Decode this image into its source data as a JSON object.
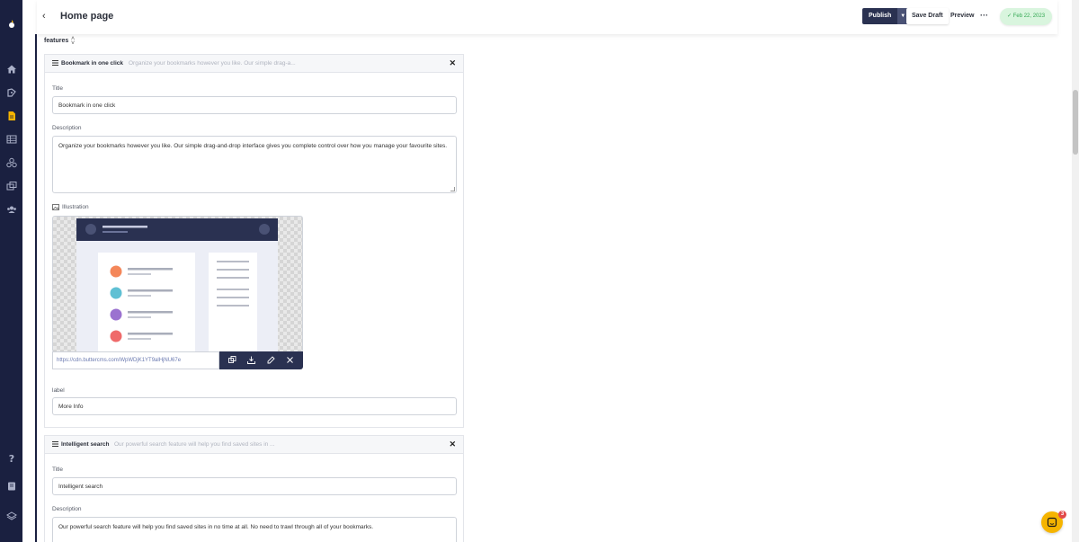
{
  "header": {
    "title": "Home page",
    "publish_label": "Publish",
    "save_draft_label": "Save Draft",
    "preview_label": "Preview",
    "more_label": "···",
    "date_badge": "Feb 22, 2023"
  },
  "section": {
    "label": "features"
  },
  "cards": [
    {
      "title": "Bookmark in one click",
      "preview": "Organize your bookmarks however you like. Our simple drag-a...",
      "close": "✕",
      "fields": {
        "title_label": "Title",
        "title_value": "Bookmark in one click",
        "description_label": "Description",
        "description_value": "Organize your bookmarks however you like. Our simple drag-and-drop interface gives you complete control over how you manage your favourite sites.",
        "illustration_label": "Illustration",
        "illustration_url": "https://cdn.buttercms.com/WpWDjK1YT9alHjNU67e",
        "label_label": "label",
        "label_value": "More Info"
      }
    },
    {
      "title": "Intelligent search",
      "preview": "Our powerful search feature will help you find saved sites in ...",
      "close": "✕",
      "fields": {
        "title_label": "Title",
        "title_value": "Intelligent search",
        "description_label": "Description",
        "description_value": "Our powerful search feature will help you find saved sites in no time at all. No need to trawl through all of your bookmarks."
      }
    }
  ],
  "chat": {
    "badge_count": "3"
  },
  "colors": {
    "nav": "#1a2040",
    "primary": "#2a3151",
    "success_bg": "#d9f5de",
    "success_text": "#34a853",
    "chat": "#f5b400"
  },
  "icons": {
    "nav": [
      "logo-icon",
      "home-icon",
      "blog-icon",
      "pages-icon",
      "collections-icon",
      "components-icon",
      "media-icon",
      "users-icon",
      "help-icon",
      "docs-icon",
      "stack-icon"
    ]
  }
}
